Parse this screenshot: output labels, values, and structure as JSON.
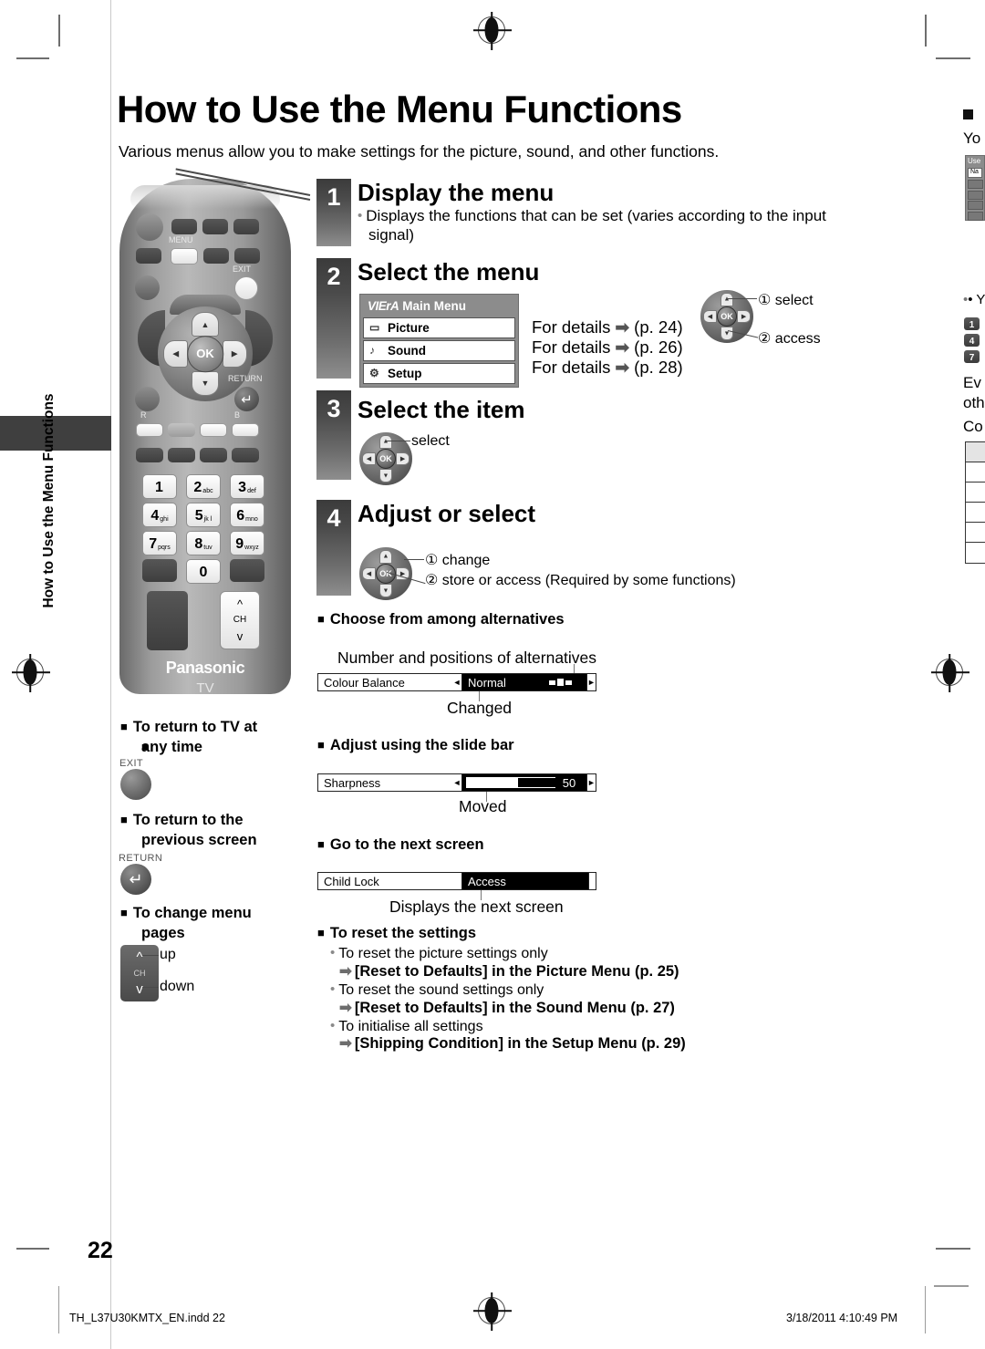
{
  "page": {
    "title": "How to Use the Menu Functions",
    "intro": "Various menus allow you to make settings for the picture, sound, and other functions.",
    "number": "22",
    "side_tab_text": "How to Use the Menu Functions"
  },
  "steps": [
    {
      "num": "1",
      "heading": "Display the menu",
      "body_line1": "Displays the functions that can be set (varies according to the input",
      "body_line2": "signal)"
    },
    {
      "num": "2",
      "heading": "Select the menu"
    },
    {
      "num": "3",
      "heading": "Select the item"
    },
    {
      "num": "4",
      "heading": "Adjust or select"
    }
  ],
  "viera_menu": {
    "logo": "VIErA",
    "title": "Main Menu",
    "items": [
      {
        "icon": "picture-icon",
        "glyph": "▭",
        "label": "Picture",
        "details": "For details",
        "page": "(p. 24)"
      },
      {
        "icon": "sound-icon",
        "glyph": "♪",
        "label": "Sound",
        "details": "For details",
        "page": "(p. 26)"
      },
      {
        "icon": "setup-icon",
        "glyph": "⚙",
        "label": "Setup",
        "details": "For details",
        "page": "(p. 28)"
      }
    ],
    "arrow": "➡"
  },
  "pad_callouts": {
    "step2_a": "① select",
    "step2_b": "② access",
    "step3_a": "select",
    "step4_a": "① change",
    "step4_b": "② store or access (Required by some functions)",
    "ok_label": "OK"
  },
  "alternatives": {
    "heading": "Choose from among alternatives",
    "top_caption": "Number and positions of alternatives",
    "bottom_caption": "Changed",
    "bar": {
      "label": "Colour Balance",
      "value": "Normal",
      "left_caret": "◄",
      "right_caret": "►"
    }
  },
  "slidebar": {
    "heading": "Adjust using the slide bar",
    "bottom_caption": "Moved",
    "bar": {
      "label": "Sharpness",
      "value": "50",
      "fill_percent": 50,
      "left_caret": "◄",
      "right_caret": "►"
    }
  },
  "nextscreen": {
    "heading": "Go to the next screen",
    "bottom_caption": "Displays the next screen",
    "bar": {
      "label": "Child Lock",
      "value": "Access"
    }
  },
  "reset": {
    "heading": "To reset the settings",
    "items": [
      {
        "note": "To reset the picture settings only",
        "action": "[Reset to Defaults] in the Picture Menu (p. 25)"
      },
      {
        "note": "To reset the sound settings only",
        "action": "[Reset to Defaults] in the Sound Menu (p. 27)"
      },
      {
        "note": "To initialise all settings",
        "action": "[Shipping Condition] in the Setup Menu (p. 29)"
      }
    ],
    "arrow": "➡"
  },
  "left_notes": [
    {
      "heading_l1": "To return to TV at",
      "heading_l2": "any time",
      "key": "EXIT"
    },
    {
      "heading_l1": "To return to the",
      "heading_l2": "previous screen",
      "key": "RETURN"
    },
    {
      "heading_l1": "To change menu",
      "heading_l2": "pages",
      "key": "CH",
      "up": "up",
      "down": "down"
    }
  ],
  "remote": {
    "menu_label": "MENU",
    "exit_label": "EXIT",
    "return_label": "RETURN",
    "brand": "Panasonic",
    "device": "TV",
    "ch_label": "CH",
    "colour_keys": [
      "R",
      "B"
    ],
    "numbers": [
      {
        "d": "1",
        "s": ""
      },
      {
        "d": "2",
        "s": "abc"
      },
      {
        "d": "3",
        "s": "def"
      },
      {
        "d": "4",
        "s": "ghi"
      },
      {
        "d": "5",
        "s": "jk l"
      },
      {
        "d": "6",
        "s": "mno"
      },
      {
        "d": "7",
        "s": "pqrs"
      },
      {
        "d": "8",
        "s": "tuv"
      },
      {
        "d": "9",
        "s": "wxyz"
      },
      {
        "d": "0",
        "s": ""
      }
    ]
  },
  "bleed": {
    "line1": "Yo",
    "line2": "Use",
    "line3": "Na",
    "line4": "• Y",
    "line5": "Ev",
    "line6": "oth",
    "line7": "Co",
    "keys": [
      "1",
      "4",
      "7"
    ]
  },
  "footer": {
    "file": "TH_L37U30KMTX_EN.indd   22",
    "timestamp": "3/18/2011   4:10:49 PM"
  }
}
